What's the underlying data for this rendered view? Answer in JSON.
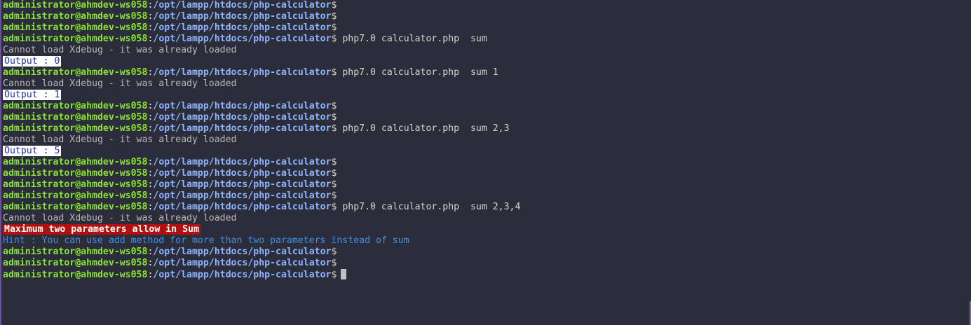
{
  "prompt": {
    "user_host": "administrator@ahmdev-ws058",
    "separator": ":",
    "path": "/opt/lampp/htdocs/php-calculator",
    "symbol": "$"
  },
  "lines": [
    {
      "type": "prompt",
      "command": ""
    },
    {
      "type": "prompt",
      "command": ""
    },
    {
      "type": "prompt",
      "command": ""
    },
    {
      "type": "prompt",
      "command": " php7.0 calculator.php  sum"
    },
    {
      "type": "warning",
      "text": "Cannot load Xdebug - it was already loaded"
    },
    {
      "type": "output",
      "text": "Output : 0"
    },
    {
      "type": "prompt",
      "command": " php7.0 calculator.php  sum 1"
    },
    {
      "type": "warning",
      "text": "Cannot load Xdebug - it was already loaded"
    },
    {
      "type": "output",
      "text": "Output : 1"
    },
    {
      "type": "prompt",
      "command": ""
    },
    {
      "type": "prompt",
      "command": ""
    },
    {
      "type": "prompt",
      "command": " php7.0 calculator.php  sum 2,3"
    },
    {
      "type": "warning",
      "text": "Cannot load Xdebug - it was already loaded"
    },
    {
      "type": "output",
      "text": "Output : 5"
    },
    {
      "type": "prompt",
      "command": ""
    },
    {
      "type": "prompt",
      "command": ""
    },
    {
      "type": "prompt",
      "command": ""
    },
    {
      "type": "prompt",
      "command": ""
    },
    {
      "type": "prompt",
      "command": " php7.0 calculator.php  sum 2,3,4"
    },
    {
      "type": "warning",
      "text": "Cannot load Xdebug - it was already loaded"
    },
    {
      "type": "error",
      "text": "Maximum two parameters allow in Sum"
    },
    {
      "type": "hint",
      "text": "Hint : You can use add method for more than two parameters instead of sum"
    },
    {
      "type": "prompt",
      "command": ""
    },
    {
      "type": "prompt",
      "command": ""
    },
    {
      "type": "prompt",
      "command": "",
      "cursor": true
    }
  ],
  "colors": {
    "background": "#2b2d3a",
    "user": "#8ae234",
    "path": "#8fb4ff",
    "error_bg": "#b30f0f",
    "hint": "#3f8fe8",
    "output_bg": "#ffffff",
    "output_fg": "#1a2fb3"
  }
}
